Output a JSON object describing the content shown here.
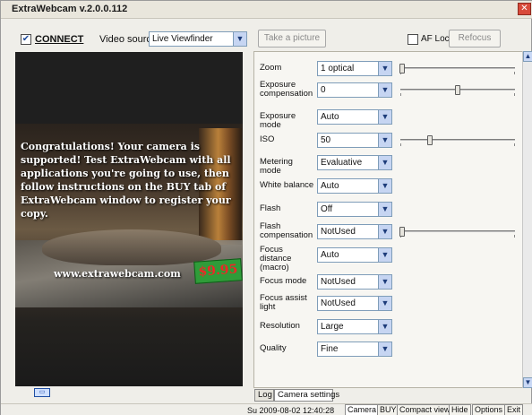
{
  "window": {
    "title": "ExtraWebcam v.2.0.0.112",
    "close_glyph": "✕"
  },
  "toolbar": {
    "connect_checked": true,
    "connect_label": "CONNECT",
    "video_source_label": "Video source",
    "video_source_value": "Live Viewfinder",
    "take_picture_label": "Take a picture",
    "af_lock_checked": false,
    "af_lock_label": "AF Lock",
    "refocus_label": "Refocus"
  },
  "preview": {
    "message": "Congratulations! Your camera is supported! Test ExtraWebcam with all applications you're going to use, then follow instructions on the BUY tab of ExtraWebcam window to register your copy.",
    "url": "www.extrawebcam.com",
    "price_tag": "$9.95"
  },
  "settings": [
    {
      "label": "Zoom",
      "value": "1 optical",
      "has_slider": true,
      "slider_level": 0.0
    },
    {
      "label": "Exposure compensation",
      "value": "0",
      "has_slider": true,
      "slider_level": 0.5
    },
    {
      "label": "Exposure mode",
      "value": "Auto",
      "has_slider": false
    },
    {
      "label": "ISO",
      "value": "50",
      "has_slider": true,
      "slider_level": 0.25
    },
    {
      "label": "Metering mode",
      "value": "Evaluative",
      "has_slider": false
    },
    {
      "label": "White balance",
      "value": "Auto",
      "has_slider": false
    },
    {
      "label": "Flash",
      "value": "Off",
      "has_slider": false
    },
    {
      "label": "Flash compensation",
      "value": "NotUsed",
      "has_slider": true,
      "slider_level": 0.0
    },
    {
      "label": "Focus distance (macro)",
      "value": "Auto",
      "has_slider": false
    },
    {
      "label": "Focus mode",
      "value": "NotUsed",
      "has_slider": false
    },
    {
      "label": "Focus assist light",
      "value": "NotUsed",
      "has_slider": false
    },
    {
      "label": "Resolution",
      "value": "Large",
      "has_slider": false
    },
    {
      "label": "Quality",
      "value": "Fine",
      "has_slider": false
    }
  ],
  "panel_tabs": [
    "Log",
    "Camera settings"
  ],
  "status": {
    "datetime": "Su 2009-08-02  12:40:28",
    "nav": [
      "Camera",
      "BUY",
      "Compact view",
      "Hide",
      "Options",
      "Exit"
    ],
    "active_nav": "Camera"
  },
  "icons": {
    "dropdown": "chevron-down-icon",
    "check": "checkmark-icon",
    "scroll_up": "arrow-up-icon",
    "scroll_down": "arrow-down-icon",
    "monitor": "monitor-icon"
  },
  "colors": {
    "accent": "#7f9db9",
    "price_tag_bg": "#2f9c39",
    "price_tag_text": "#ee2727",
    "close_red": "#d84a3a"
  }
}
